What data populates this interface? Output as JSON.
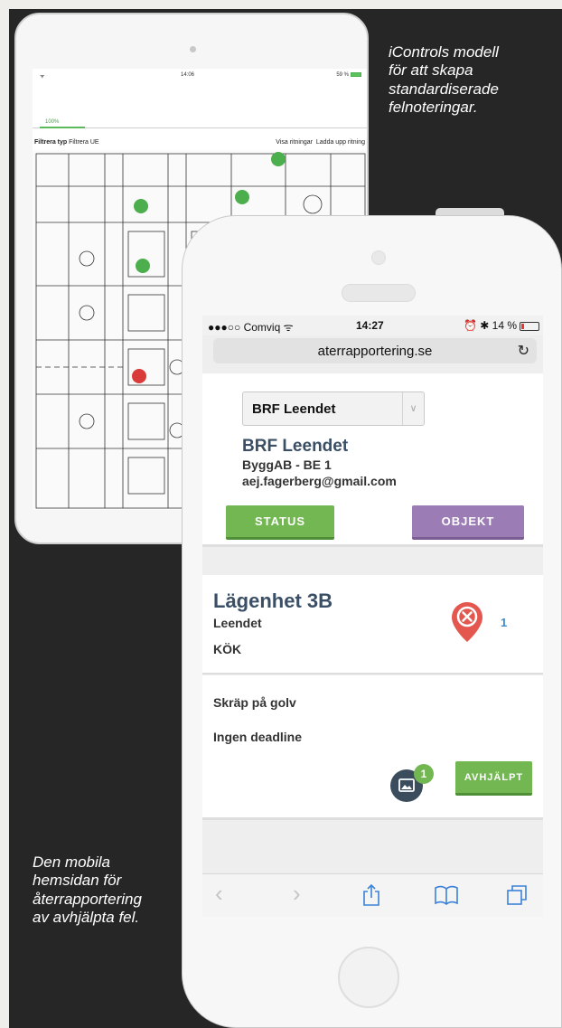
{
  "captions": {
    "top": [
      "iControls modell",
      "för att skapa",
      "standardiserade",
      "felnoteringar."
    ],
    "bottom": [
      "Den mobila",
      "hemsidan för",
      "återrapportering",
      "av avhjälpta fel."
    ]
  },
  "ipad": {
    "status": {
      "clock": "14:06",
      "battery": "59 %"
    },
    "progress": {
      "label": "100%",
      "value": 1.0
    },
    "filters": {
      "type_label": "Filtrera typ",
      "ue_label": "Filtrera UE",
      "show_drawings": "Visa ritningar",
      "upload_drawing": "Ladda upp ritning"
    }
  },
  "phone": {
    "status": {
      "carrier": "●●●○○ Comviq",
      "time": "14:27",
      "battery": "14 %"
    },
    "url": "aterrapportering.se",
    "header": {
      "select_value": "BRF Leendet",
      "title": "BRF Leendet",
      "subtitle": "ByggAB - BE 1",
      "email": "aej.fagerberg@gmail.com",
      "status_button": "STATUS",
      "objekt_button": "OBJEKT"
    },
    "apartment": {
      "title": "Lägenhet 3B",
      "subtitle": "Leendet",
      "room": "KÖK",
      "pin_count": "1"
    },
    "issue": {
      "text": "Skräp på golv",
      "deadline": "Ingen deadline",
      "photo_count": "1",
      "resolve_button": "AVHJÄLPT"
    }
  },
  "colors": {
    "green": "#72b752",
    "purple": "#9b7cb4",
    "navy": "#3a4f65",
    "pin_red": "#e3574f",
    "ios_blue": "#3b82d8"
  }
}
